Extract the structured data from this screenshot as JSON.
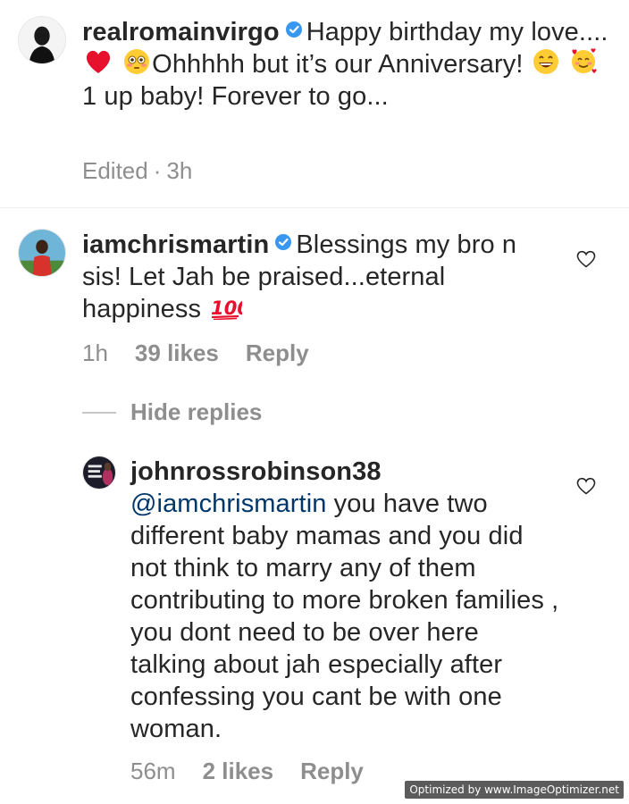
{
  "comments": [
    {
      "username": "realromainvirgo",
      "verified": true,
      "text_parts": [
        "Happy birthday my love....",
        "Ohhhhh but it’s our Anniversary!",
        "1 up baby! Forever to go..."
      ],
      "emojis": [
        "red-heart",
        "flushed-face",
        "grinning-face",
        "smiling-face-with-hearts"
      ],
      "meta": {
        "edited": "Edited",
        "separator": "·",
        "time": "3h"
      }
    },
    {
      "username": "iamchrismartin",
      "verified": true,
      "text": "Blessings my bro n sis! Let Jah be praised...eternal happiness",
      "emojis": [
        "hundred-points"
      ],
      "meta": {
        "time": "1h",
        "likes": "39 likes",
        "reply": "Reply"
      }
    }
  ],
  "replies_toggle": {
    "label": "Hide replies"
  },
  "reply": {
    "username": "johnrossrobinson38",
    "mention": "@iamchrismartin",
    "text": "you have two different baby mamas and you did not think to marry any of them contributing to more broken families , you dont need to be over here talking about jah especially after confessing you cant be with one woman.",
    "meta": {
      "time": "56m",
      "likes": "2 likes",
      "reply": "Reply"
    }
  },
  "watermark": "Optimized by www.ImageOptimizer.net",
  "colors": {
    "text": "#262626",
    "meta": "#8e8e8e",
    "mention": "#00376b",
    "verified": "#3897f0"
  }
}
